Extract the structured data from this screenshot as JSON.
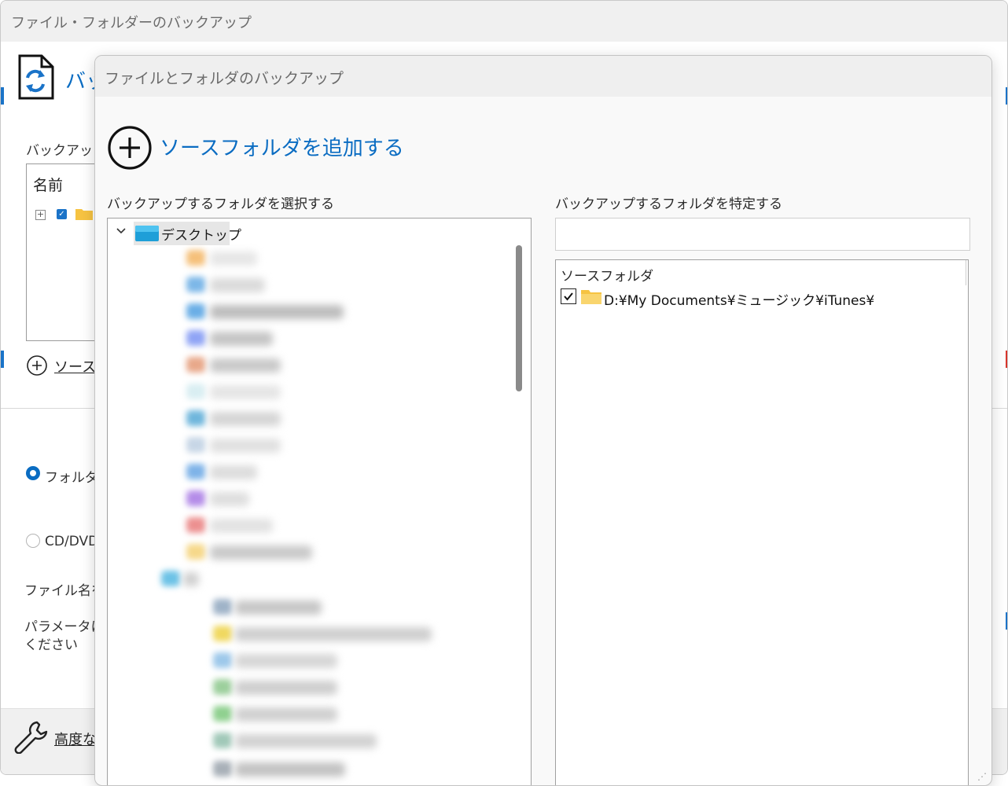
{
  "outer_window": {
    "title": "ファイル・フォルダーのバックアップ",
    "header_title": "バッ",
    "backup_label": "バックアップソ",
    "list_column_name": "名前",
    "add_source_link": "ソースフ",
    "radio_folder": "フォルダ",
    "radio_cd": "CD/DVD",
    "filename_label": "ファイル名を",
    "param_label_line1": "パラメータにに",
    "param_label_line2": "ください",
    "advanced_link": "高度な"
  },
  "dialog": {
    "title": "ファイルとフォルダのバックアップ",
    "add_source": "ソースフォルダを追加する",
    "left_label": "バックアップするフォルダを選択する",
    "right_label": "バックアップするフォルダを特定する",
    "tree_root": "デスクトップ",
    "spec_input_value": "",
    "source_header": "ソースフォルダ",
    "source_items": [
      {
        "path": "D:¥My Documents¥ミュージック¥iTunes¥",
        "checked": true
      }
    ]
  },
  "colors": {
    "accent": "#0a6cc2",
    "folder": "#f6c342"
  }
}
